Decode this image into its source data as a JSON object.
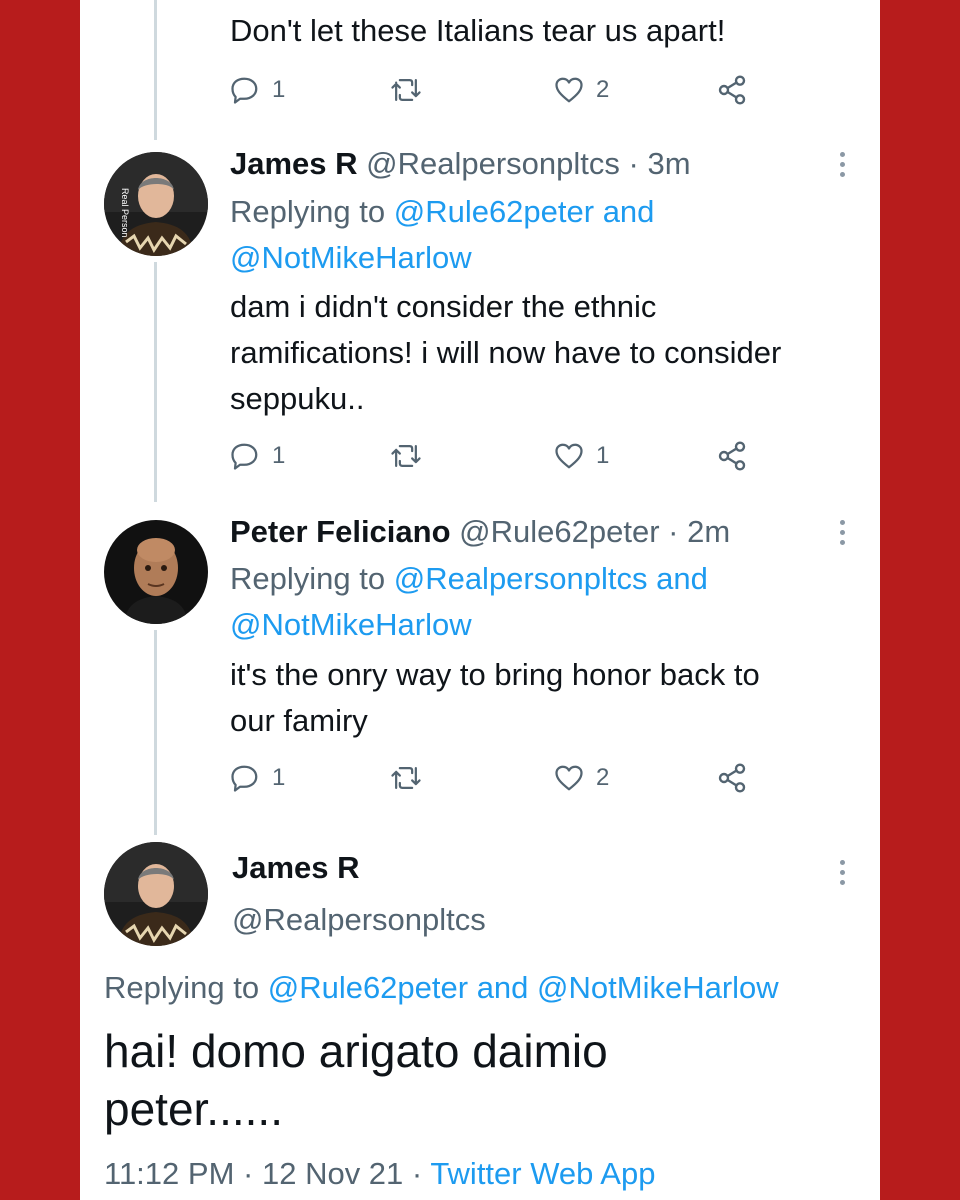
{
  "colors": {
    "accent": "#1d9bf0",
    "frame": "#b71c1c",
    "muted": "#536471",
    "text": "#0f1419"
  },
  "tweets": [
    {
      "text": "Don't let these Italians tear us apart!",
      "actions": {
        "reply": "1",
        "retweet": "",
        "like": "2"
      }
    },
    {
      "name": "James R",
      "handle": "@Realpersonpltcs",
      "sep": "·",
      "time": "3m",
      "replying_prefix": "Replying to",
      "replying_line1": "@Rule62peter and",
      "replying_line2": "@NotMikeHarlow",
      "text_lines": [
        "dam i didn't consider the ethnic",
        "ramifications! i will now have to consider",
        "seppuku.."
      ],
      "actions": {
        "reply": "1",
        "retweet": "",
        "like": "1"
      }
    },
    {
      "name": "Peter Feliciano",
      "handle": "@Rule62peter",
      "sep": "·",
      "time": "2m",
      "replying_prefix": "Replying to",
      "replying_line1": "@Realpersonpltcs and",
      "replying_line2": "@NotMikeHarlow",
      "text_lines": [
        "it's the onry way to bring honor back to",
        "our famiry"
      ],
      "actions": {
        "reply": "1",
        "retweet": "",
        "like": "2"
      }
    }
  ],
  "main_tweet": {
    "name": "James R",
    "handle": "@Realpersonpltcs",
    "replying_prefix": "Replying to",
    "replying_targets": "@Rule62peter and @NotMikeHarlow",
    "text_lines": [
      "hai! domo arigato daimio",
      "peter......"
    ],
    "time": "11:12 PM",
    "sep": "·",
    "date": "12 Nov 21",
    "source": "Twitter Web App"
  },
  "icons": [
    "reply-icon",
    "retweet-icon",
    "like-icon",
    "share-icon",
    "more-icon"
  ],
  "avatar_watermark": "Real Person"
}
